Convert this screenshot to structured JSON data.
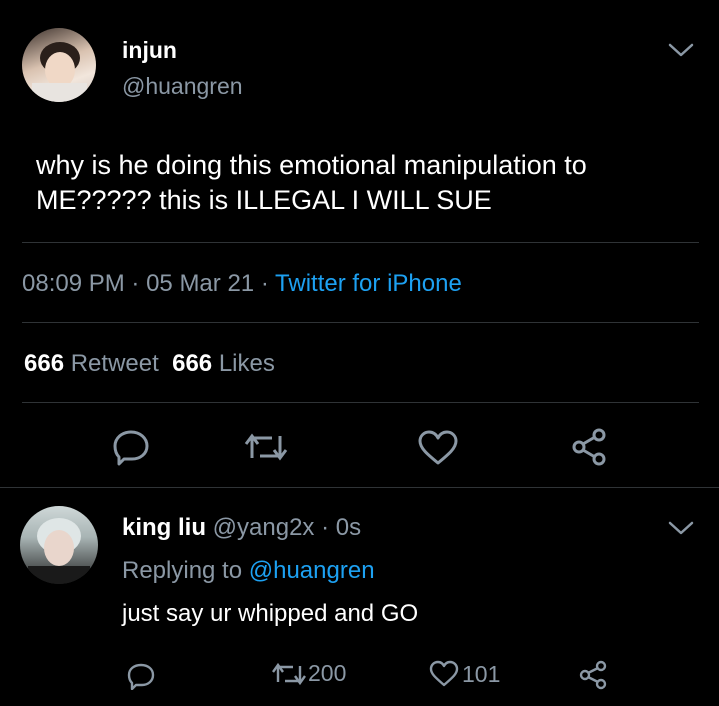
{
  "main_tweet": {
    "display_name": "injun",
    "handle": "@huangren",
    "text_line1": "why is he doing this emotional manipulation to",
    "text_line2": "ME????? this is ILLEGAL I WILL SUE",
    "time": "08:09 PM",
    "sep1": "·",
    "date": "05 Mar 21",
    "sep2": "·",
    "source": "Twitter for iPhone",
    "retweet_count": "666",
    "retweet_label": "Retweet",
    "like_count": "666",
    "like_label": "Likes"
  },
  "reply": {
    "display_name": "king liu",
    "handle": "@yang2x",
    "sep": "·",
    "age": "0s",
    "replying_prefix": "Replying to",
    "replying_to": "@huangren",
    "text": "just say ur whipped and GO",
    "retweet_count": "200",
    "like_count": "101"
  },
  "colors": {
    "background": "#000000",
    "accent": "#1da1f2",
    "muted": "#8b98a5",
    "divider": "#2f3336"
  },
  "icons": [
    "chevron-down-icon",
    "reply-icon",
    "retweet-icon",
    "like-icon",
    "share-icon"
  ]
}
